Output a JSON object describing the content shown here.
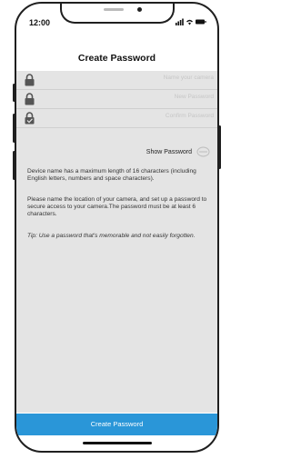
{
  "status_bar": {
    "time": "12:00",
    "icons": "..ıl ≈ ▬"
  },
  "header": {
    "title": "Create Password"
  },
  "form": {
    "fields": [
      {
        "placeholder": "Name your camera",
        "value": ""
      },
      {
        "placeholder": "New Password",
        "value": ""
      },
      {
        "placeholder": "Confirm Password",
        "value": ""
      }
    ],
    "show_password_label": "Show Password"
  },
  "info": {
    "paragraph1": "Device name has a maximum length of 16 characters (including English letters, numbers and space characters).",
    "paragraph2": "Please name the location of your camera, and set up a password to secure access to your camera.The password must be at least 6 characters.",
    "tip": "Tip: Use a password that's memorable and not easily forgotten."
  },
  "actions": {
    "submit_label": "Create Password"
  },
  "colors": {
    "accent": "#2a96d8",
    "content_bg": "#e4e4e4"
  }
}
